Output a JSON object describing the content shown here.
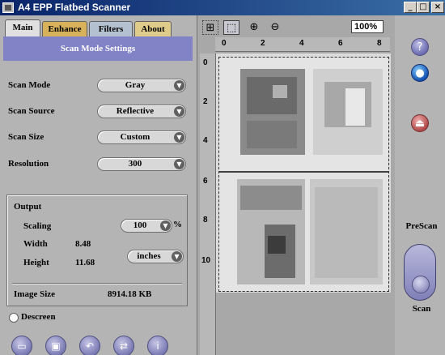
{
  "window": {
    "title": "A4 EPP Flatbed Scanner",
    "minimize_glyph": "_",
    "maximize_glyph": "□",
    "close_glyph": "×"
  },
  "tabs": [
    {
      "label": "Main",
      "active": true
    },
    {
      "label": "Enhance",
      "active": false
    },
    {
      "label": "Filters",
      "active": false
    },
    {
      "label": "About",
      "active": false
    }
  ],
  "panel": {
    "header": "Scan Mode Settings",
    "settings": [
      {
        "label": "Scan Mode",
        "value": "Gray"
      },
      {
        "label": "Scan Source",
        "value": "Reflective"
      },
      {
        "label": "Scan Size",
        "value": "Custom"
      },
      {
        "label": "Resolution",
        "value": "300"
      }
    ],
    "dropdown_arrow": "▼"
  },
  "output": {
    "title": "Output",
    "scaling_label": "Scaling",
    "scaling_value": "100",
    "scaling_unit": "%",
    "width_label": "Width",
    "width_value": "8.48",
    "height_label": "Height",
    "height_value": "11.68",
    "units": "inches",
    "image_size_label": "Image Size",
    "image_size_value": "8914.18 KB"
  },
  "descreen": {
    "label": "Descreen",
    "checked": false
  },
  "bottom_toolbar": [
    "folder-icon",
    "save-icon",
    "undo-icon",
    "rotate-icon",
    "info-icon"
  ],
  "preview": {
    "tools": [
      "selection-icon",
      "selection-active-icon",
      "zoom-in-icon",
      "zoom-out-icon"
    ],
    "zoom_level": "100%",
    "ruler_top": [
      "0",
      "2",
      "4",
      "6",
      "8"
    ],
    "ruler_left": [
      "0",
      "2",
      "4",
      "6",
      "8",
      "10"
    ]
  },
  "side_panel": {
    "help_glyph": "?",
    "prescan_label": "PreScan",
    "scan_label": "Scan"
  }
}
